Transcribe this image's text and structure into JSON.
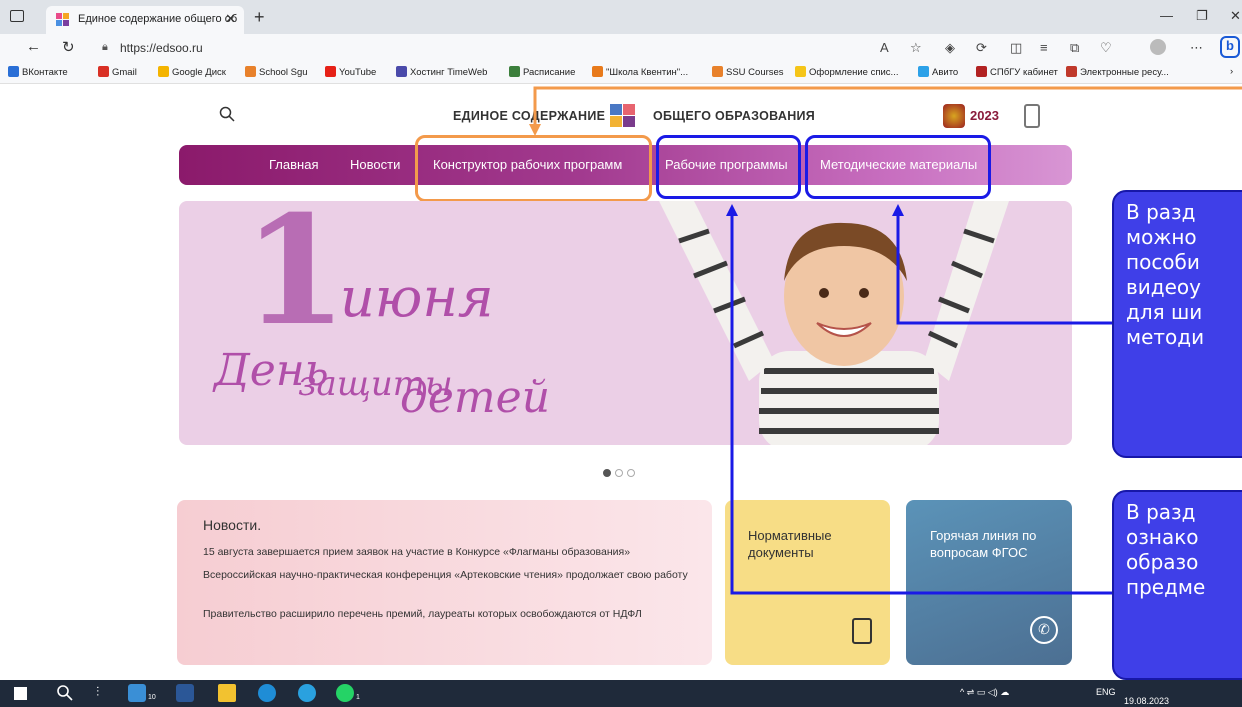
{
  "browser": {
    "tab_title": "Единое содержание общего об",
    "url": "https://edsoo.ru",
    "bookmarks": [
      "ВКонтакте",
      "Gmail",
      "Google Диск",
      "School Sgu",
      "YouTube",
      "Хостинг TimeWeb",
      "Расписание",
      "\"Школа Квентин\"...",
      "SSU Courses",
      "Оформление спис...",
      "Авито",
      "СПбГУ кабинет",
      "Электронные ресу..."
    ]
  },
  "site": {
    "title_left": "ЕДИНОЕ СОДЕРЖАНИЕ",
    "title_right": "ОБЩЕГО ОБРАЗОВАНИЯ",
    "nav": [
      "Главная",
      "Новости",
      "Конструктор рабочих программ",
      "Рабочие программы",
      "Методические материалы"
    ]
  },
  "banner": {
    "number": "1",
    "month": "июня",
    "line1": "День",
    "line2": "защиты",
    "line3": "детей"
  },
  "news": {
    "title": "Новости.",
    "items": [
      "15 августа завершается прием заявок на участие в Конкурсе «Флагманы образования»",
      "Всероссийская научно-практическая конференция «Артековские чтения» продолжает свою работу",
      "Правительство расширило перечень премий, лауреаты которых освобождаются от НДФЛ"
    ]
  },
  "cards": {
    "normative": "Нормативные документы",
    "hotline": "Горячая линия по вопросам ФГОС"
  },
  "callouts": {
    "top": [
      "В разд",
      "можно",
      "пособи",
      "видеоу",
      "для ши",
      "методи"
    ],
    "bottom": [
      "В разд",
      "ознако",
      "образо",
      "предме"
    ]
  },
  "taskbar": {
    "lang": "ENG",
    "date": "19.08.2023",
    "badge1": "10",
    "badge2": "1"
  },
  "colors": {
    "nav_start": "#8b1a6b",
    "highlight_orange": "#f39a4b",
    "highlight_blue": "#1a1ae6",
    "callout_bg": "#3f3fe8"
  }
}
